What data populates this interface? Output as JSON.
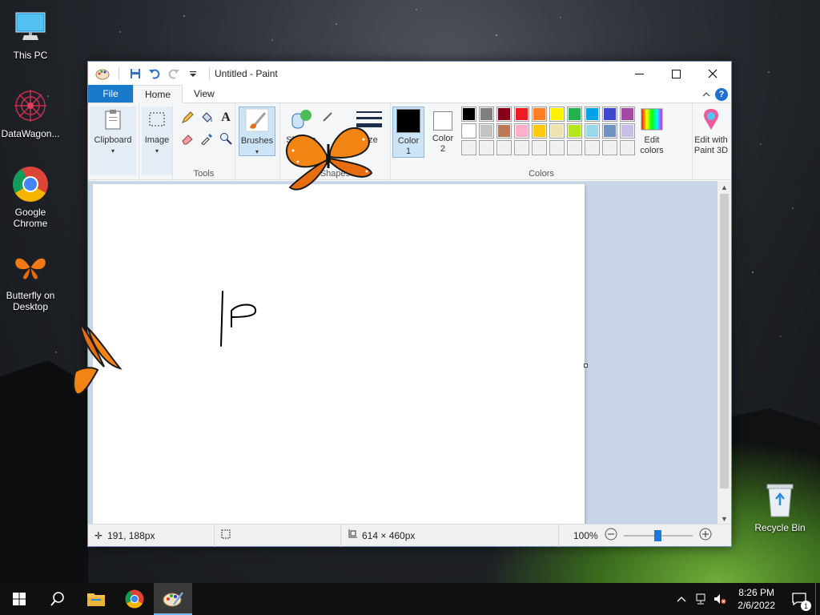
{
  "desktop": {
    "icons": [
      {
        "label": "This PC"
      },
      {
        "label": "DataWagon..."
      },
      {
        "label": "Google\nChrome"
      },
      {
        "label": "Butterfly on\nDesktop"
      },
      {
        "label": "Recycle Bin"
      }
    ]
  },
  "window": {
    "title": "Untitled - Paint",
    "tabs": [
      "File",
      "Home",
      "View"
    ],
    "help_label": "?"
  },
  "ribbon": {
    "clipboard_label": "Clipboard",
    "image_label": "Image",
    "tools_label": "Tools",
    "brushes_label": "Brushes",
    "shapes_label": "Shapes",
    "shapes_group_label": "Shapes",
    "size_label": "Size",
    "color1_label": "Color\n1",
    "color2_label": "Color\n2",
    "colors_group_label": "Colors",
    "edit_colors_label": "Edit\ncolors",
    "paint3d_label": "Edit with\nPaint 3D",
    "color1": "#000000",
    "color2": "#ffffff",
    "palette": [
      "#000000",
      "#7f7f7f",
      "#880015",
      "#ed1c24",
      "#ff7f27",
      "#fff200",
      "#22b14c",
      "#00a2e8",
      "#3f48cc",
      "#a349a4",
      "#ffffff",
      "#c3c3c3",
      "#b97a57",
      "#ffaec9",
      "#ffc90e",
      "#efe4b0",
      "#b5e61d",
      "#99d9ea",
      "#7092be",
      "#c8bfe7",
      "#f0f0f0",
      "#f0f0f0",
      "#f0f0f0",
      "#f0f0f0",
      "#f0f0f0",
      "#f0f0f0",
      "#f0f0f0",
      "#f0f0f0",
      "#f0f0f0",
      "#f0f0f0"
    ]
  },
  "status": {
    "cursor_pos": "191, 188px",
    "image_size": "614 × 460px",
    "zoom": "100%",
    "zoom_slider_fraction": 0.5
  },
  "taskbar": {
    "time": "8:26 PM",
    "date": "2/6/2022",
    "notification_count": "1"
  }
}
